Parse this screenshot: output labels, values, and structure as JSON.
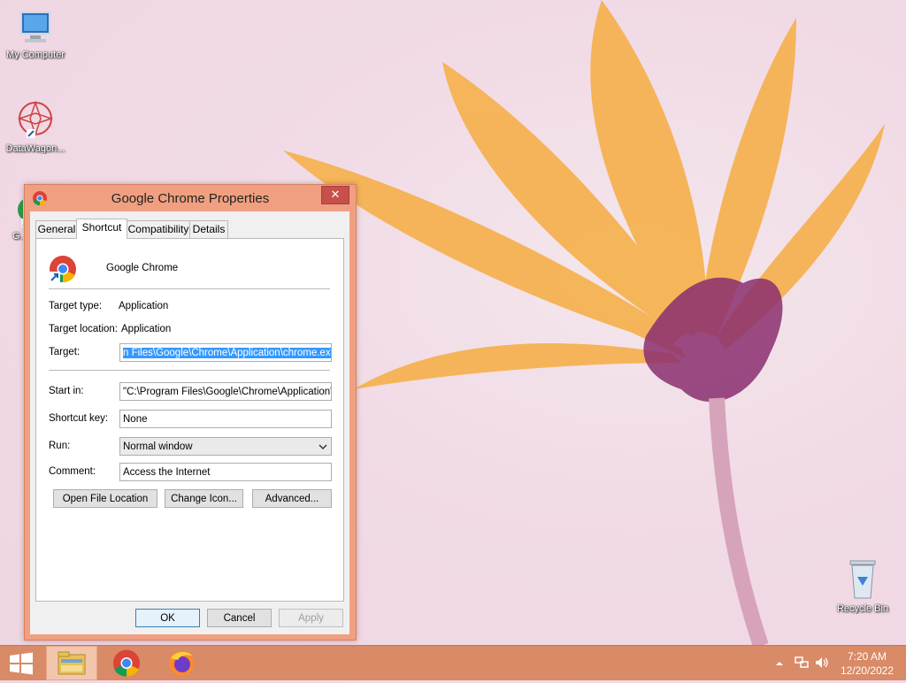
{
  "desktop": {
    "icons": [
      {
        "label": "My Computer",
        "icon": "computer-icon"
      },
      {
        "label": "DataWagon...",
        "icon": "datawagon-icon"
      },
      {
        "label": "G...",
        "icon": "chrome-shortcut-icon"
      },
      {
        "label": "Recycle Bin",
        "icon": "recycle-bin-icon"
      }
    ]
  },
  "dialog": {
    "title": "Google Chrome Properties",
    "close_glyph": "✕",
    "tabs": [
      {
        "label": "General",
        "active": false
      },
      {
        "label": "Shortcut",
        "active": true
      },
      {
        "label": "Compatibility",
        "active": false
      },
      {
        "label": "Details",
        "active": false
      }
    ],
    "shortcut": {
      "name": "Google Chrome",
      "target_type_label": "Target type:",
      "target_type_value": "Application",
      "target_location_label": "Target location:",
      "target_location_value": "Application",
      "target_label": "Target:",
      "target_value": "n Files\\Google\\Chrome\\Application\\chrome.exe\"",
      "start_in_label": "Start in:",
      "start_in_value": "\"C:\\Program Files\\Google\\Chrome\\Application\"",
      "shortcut_key_label": "Shortcut key:",
      "shortcut_key_value": "None",
      "run_label": "Run:",
      "run_value": "Normal window",
      "comment_label": "Comment:",
      "comment_value": "Access the Internet",
      "open_file_location_label": "Open File Location",
      "change_icon_label": "Change Icon...",
      "advanced_label": "Advanced..."
    },
    "buttons": {
      "ok": "OK",
      "cancel": "Cancel",
      "apply": "Apply"
    }
  },
  "taskbar": {
    "items": [
      {
        "name": "start",
        "icon": "windows-logo-icon"
      },
      {
        "name": "file-explorer",
        "icon": "folder-icon"
      },
      {
        "name": "chrome",
        "icon": "chrome-icon"
      },
      {
        "name": "firefox",
        "icon": "firefox-icon"
      }
    ],
    "tray": {
      "time": "7:20 AM",
      "date": "12/20/2022"
    }
  },
  "colors": {
    "accent": "#d98a67",
    "window_frame": "#f0a080",
    "close_button": "#c7504a",
    "selection": "#3399ff"
  }
}
